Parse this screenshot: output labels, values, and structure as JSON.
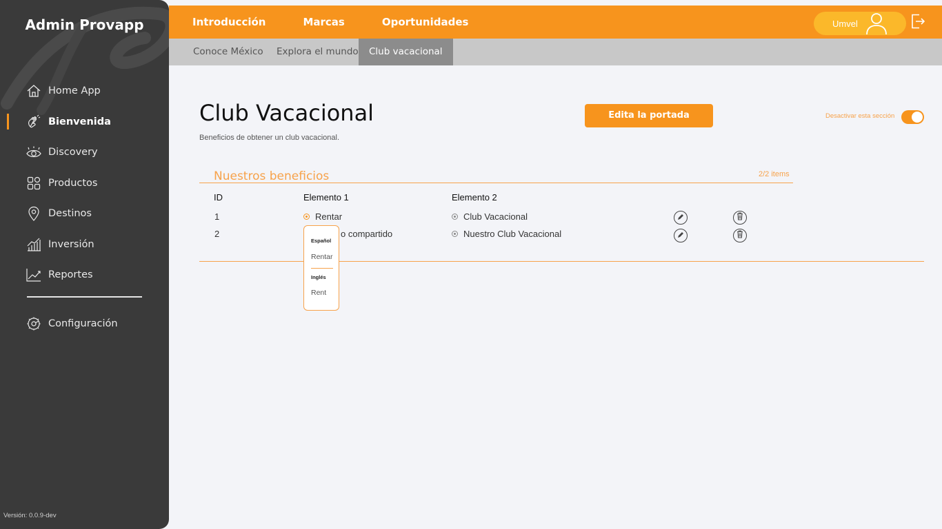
{
  "sidebar": {
    "brand": "Admin Provapp",
    "items": [
      {
        "label": "Home App",
        "icon": "home-icon"
      },
      {
        "label": "Bienvenida",
        "icon": "waving-hand-icon"
      },
      {
        "label": "Discovery",
        "icon": "eye-icon"
      },
      {
        "label": "Productos",
        "icon": "grid-icon"
      },
      {
        "label": "Destinos",
        "icon": "location-pin-icon"
      },
      {
        "label": "Inversión",
        "icon": "bar-chart-icon"
      },
      {
        "label": "Reportes",
        "icon": "line-chart-icon"
      }
    ],
    "active_item": "Bienvenida",
    "config_label": "Configuración",
    "version": "Versión: 0.0.9-dev"
  },
  "topbar": {
    "tabs": [
      "Introducción",
      "Marcas",
      "Oportunidades"
    ],
    "active_tab": "Oportunidades",
    "user_name": "Umvel"
  },
  "subbar": {
    "tabs": [
      "Conoce México",
      "Explora el mundo",
      "Club vacacional"
    ],
    "active_tab": "Club vacacional"
  },
  "main": {
    "title": "Club Vacacional",
    "subtitle": "Beneficios de obtener un club vacacional.",
    "edit_button": "Edita la portada",
    "toggle_label": "Desactivar esta sección",
    "toggle_on": true,
    "section_title": "Nuestros beneficios",
    "items_count": "2/2 items",
    "table": {
      "headers": [
        "ID",
        "Elemento 1",
        "Elemento 2"
      ],
      "rows": [
        {
          "id": "1",
          "el1": "Rentar",
          "el2": "Club Vacacional"
        },
        {
          "id": "2",
          "el1": "o compartido",
          "el2": "Nuestro Club Vacacional"
        }
      ]
    },
    "popup": {
      "lang1": "Español",
      "val1": "Rentar",
      "lang2": "Inglés",
      "val2": "Rent"
    }
  },
  "colors": {
    "accent": "#f7941d",
    "sidebar_bg": "#3a3a3a",
    "subbar_bg": "#c8c8c8",
    "subbar_active": "#8c8c8c",
    "page_bg": "#f3f4f8"
  }
}
